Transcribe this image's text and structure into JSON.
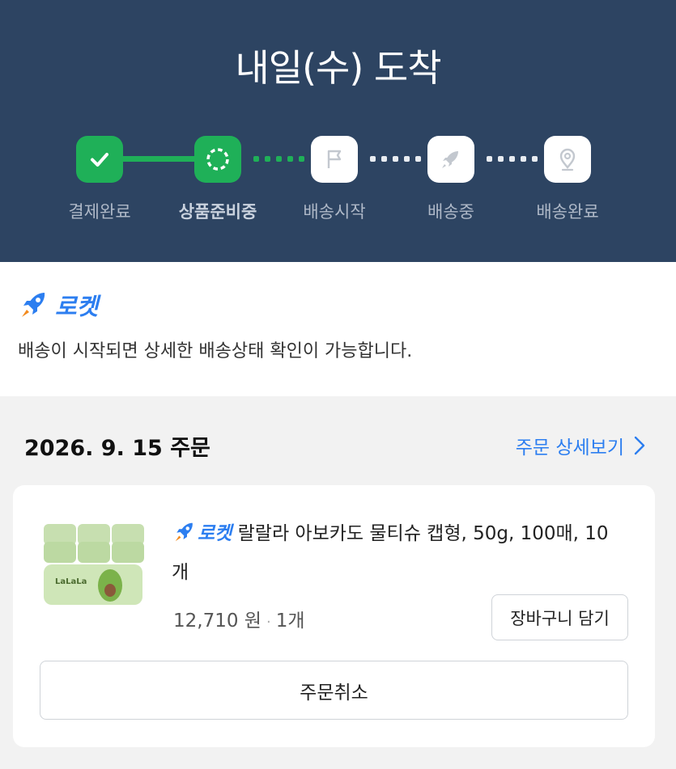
{
  "header": {
    "title": "내일(수) 도착",
    "steps": [
      {
        "label": "결제완료",
        "state": "done",
        "icon": "check-icon"
      },
      {
        "label": "상품준비중",
        "state": "current",
        "icon": "dashed-circle-icon"
      },
      {
        "label": "배송시작",
        "state": "pending",
        "icon": "flag-icon"
      },
      {
        "label": "배송중",
        "state": "pending",
        "icon": "rocket-icon"
      },
      {
        "label": "배송완료",
        "state": "pending",
        "icon": "location-pin-icon"
      }
    ],
    "colors": {
      "background": "#2d4462",
      "active": "#1fb058"
    }
  },
  "notice": {
    "badge": "로켓",
    "message": "배송이 시작되면 상세한 배송상태 확인이 가능합니다."
  },
  "order": {
    "date": "2026. 9. 15 주문",
    "detail_link": "주문 상세보기",
    "item": {
      "badge": "로켓",
      "name": "랄랄라 아보카도 물티슈 캡형, 50g, 100매, 10개",
      "price": "12,710 원",
      "quantity": "1개",
      "cart_button": "장바구니 담기",
      "thumbnail_brand": "LaLaLa"
    },
    "cancel_button": "주문취소"
  }
}
